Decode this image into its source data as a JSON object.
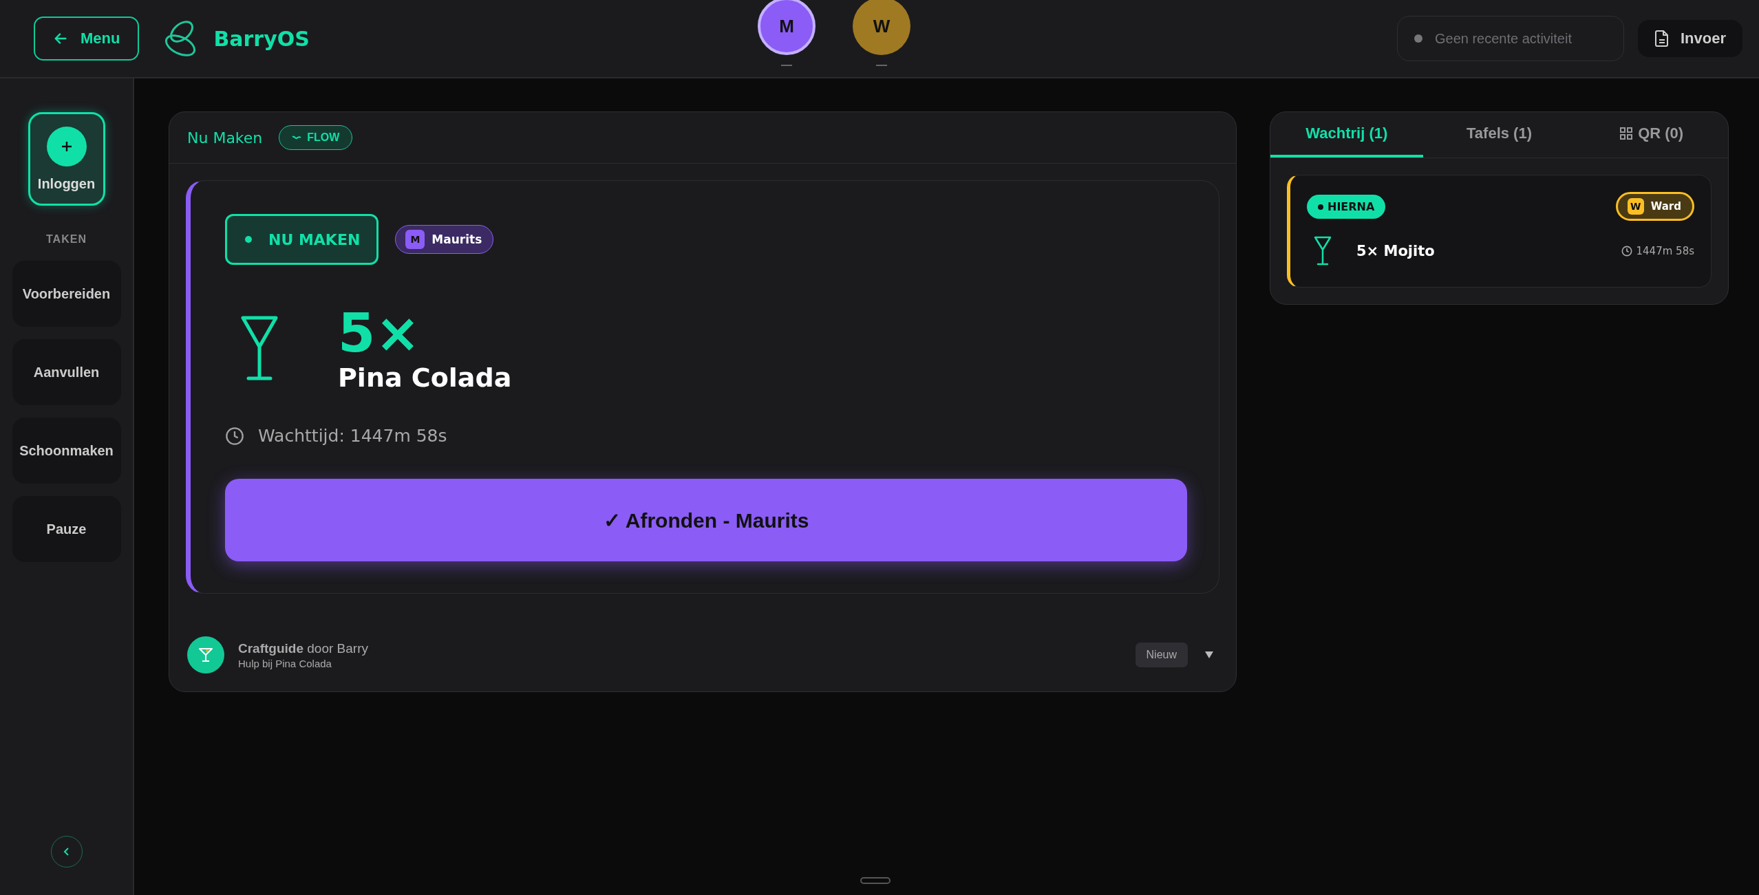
{
  "header": {
    "menu_button": "Menu",
    "brand": "BarryOS",
    "users": [
      {
        "initial": "M",
        "color": "#8b5cf6",
        "selected": true
      },
      {
        "initial": "W",
        "color": "#a07a22",
        "selected": false
      }
    ],
    "activity": "Geen recente activiteit",
    "input_button": "Invoer"
  },
  "sidebar": {
    "login_button": "Inloggen",
    "section": "TAKEN",
    "tasks": [
      "Voorbereiden",
      "Aanvullen",
      "Schoonmaken",
      "Pauze"
    ]
  },
  "current": {
    "title": "Nu Maken",
    "mode_badge": "FLOW",
    "order": {
      "status": "NU MAKEN",
      "assignee": {
        "initial": "M",
        "name": "Maurits",
        "color": "#8b5cf6"
      },
      "quantity": "5×",
      "drink": "Pina Colada",
      "wait": "Wachttijd: 1447m 58s",
      "action": "✓ Afronden - Maurits"
    },
    "guide": {
      "title": "**Craftguide** door Barry",
      "subtitle": "Hulp bij Pina Colada",
      "badge": "Nieuw",
      "expanded": false
    }
  },
  "queue": {
    "tabs": [
      {
        "label": "Wachtrij (1)",
        "selected": true,
        "kind": "text"
      },
      {
        "label": "Tafels (1)",
        "selected": false,
        "kind": "text"
      },
      {
        "label": "QR (0)",
        "selected": false,
        "kind": "qr"
      }
    ],
    "orders": [
      {
        "status": "HIERNA",
        "assignee": {
          "initial": "W",
          "name": "Ward",
          "color": "#fbbf24"
        },
        "item": "5× Mojito",
        "wait": "1447m 58s"
      }
    ]
  }
}
